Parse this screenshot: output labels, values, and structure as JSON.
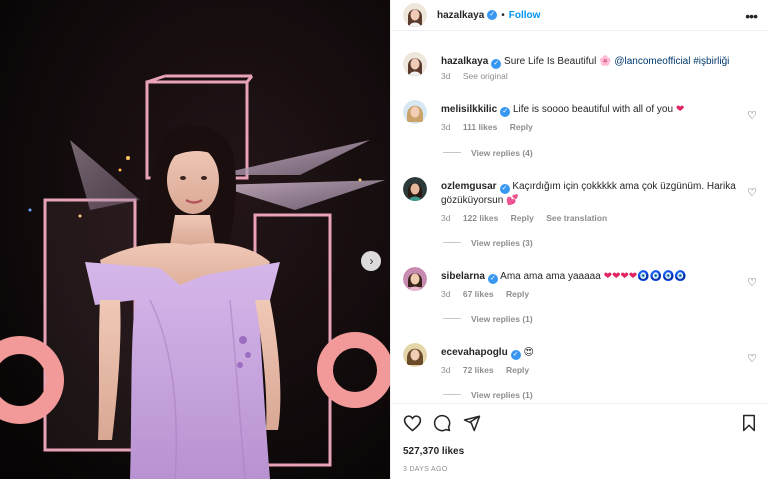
{
  "post": {
    "author": "hazalkaya",
    "follow_label": "Follow",
    "dot": "•",
    "more": "•••"
  },
  "caption": {
    "username": "hazalkaya",
    "text": "Sure Life Is Beautiful",
    "emoji": "🌸",
    "mention": "@lancomeofficial",
    "hashtag": "#işbirliği",
    "time": "3d",
    "see_original": "See original"
  },
  "comments": [
    {
      "username": "melisilkkilic",
      "text": "Life is soooo beautiful with all of you",
      "emoji": "❤",
      "time": "3d",
      "likes": "111 likes",
      "reply": "Reply",
      "view_replies": "View replies (4)"
    },
    {
      "username": "ozlemgusar",
      "text": "Kaçırdığım için çokkkkk ama çok üzgünüm. Harika gözüküyorsun",
      "emoji": "💕",
      "time": "3d",
      "likes": "122 likes",
      "reply": "Reply",
      "see_translation": "See translation",
      "view_replies": "View replies (3)"
    },
    {
      "username": "sibelarna",
      "text": "Ama ama ama yaaaaa",
      "emoji": "❤❤❤❤🧿🧿🧿🧿",
      "time": "3d",
      "likes": "67 likes",
      "reply": "Reply",
      "view_replies": "View replies (1)"
    },
    {
      "username": "ecevahapoglu",
      "text": "",
      "emoji": "😍",
      "time": "3d",
      "likes": "72 likes",
      "reply": "Reply",
      "view_replies": "View replies (1)"
    }
  ],
  "footer": {
    "likes": "527,370 likes",
    "date": "3 DAYS AGO"
  },
  "icons": {
    "heart": "heart-icon",
    "comment": "comment-icon",
    "share": "share-icon",
    "save": "bookmark-icon",
    "next": "chevron-right-icon"
  },
  "colors": {
    "accent": "#0095f6",
    "verified": "#3897f0",
    "dress": "#c9a6e0"
  }
}
